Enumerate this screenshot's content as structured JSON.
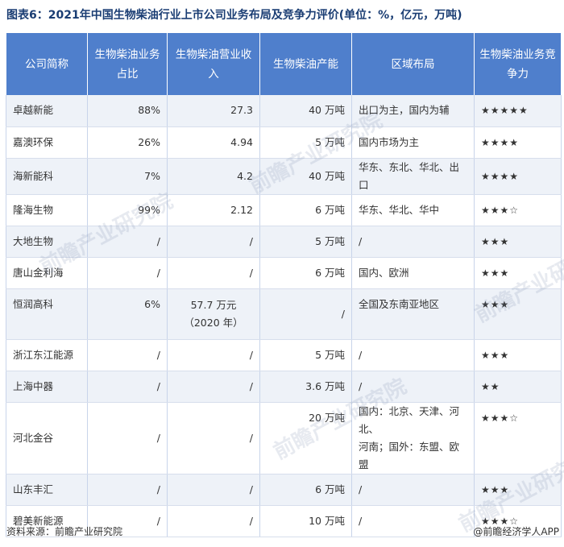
{
  "title": "图表6：2021年中国生物柴油行业上市公司业务布局及竞争力评价(单位：%，亿元，万吨)",
  "table": {
    "headers": [
      "公司简称",
      "生物柴油业务占比",
      "生物柴油营业收入",
      "生物柴油产能",
      "区域布局",
      "生物柴油业务竞争力"
    ],
    "rows": [
      {
        "name": "卓越新能",
        "share": "88%",
        "revenue": "27.3",
        "revenue2": "",
        "capacity": "40 万吨",
        "region": "出口为主，国内为辅",
        "stars": "★★★★★"
      },
      {
        "name": "嘉澳环保",
        "share": "26%",
        "revenue": "4.94",
        "revenue2": "",
        "capacity": "5 万吨",
        "region": "国内市场为主",
        "stars": "★★★★"
      },
      {
        "name": "海新能科",
        "share": "7%",
        "revenue": "4.2",
        "revenue2": "",
        "capacity": "40 万吨",
        "region": "华东、东北、华北、出口",
        "stars": "★★★★"
      },
      {
        "name": "隆海生物",
        "share": "99%",
        "revenue": "2.12",
        "revenue2": "",
        "capacity": "6 万吨",
        "region": "华东、华北、华中",
        "stars": "★★★☆"
      },
      {
        "name": "大地生物",
        "share": "/",
        "revenue": "/",
        "revenue2": "",
        "capacity": "5 万吨",
        "region": "/",
        "stars": "★★★"
      },
      {
        "name": "唐山金利海",
        "share": "/",
        "revenue": "/",
        "revenue2": "",
        "capacity": "6 万吨",
        "region": "国内、欧洲",
        "stars": "★★★"
      },
      {
        "name": "恒润高科",
        "share": "6%",
        "revenue": "57.7 万元",
        "revenue2": "（2020 年）",
        "capacity": "/",
        "region": "全国及东南亚地区",
        "stars": "★★★"
      },
      {
        "name": "浙江东江能源",
        "share": "/",
        "revenue": "/",
        "revenue2": "",
        "capacity": "5 万吨",
        "region": "/",
        "stars": "★★★"
      },
      {
        "name": "上海中器",
        "share": "/",
        "revenue": "/",
        "revenue2": "",
        "capacity": "3.6 万吨",
        "region": "/",
        "stars": "★★"
      },
      {
        "name": "河北金谷",
        "share": "/",
        "revenue": "/",
        "revenue2": "",
        "capacity": "20 万吨",
        "region": "国内：北京、天津、河北、",
        "region2": "河南；国外：东盟、欧盟",
        "stars": "★★★☆"
      },
      {
        "name": "山东丰汇",
        "share": "/",
        "revenue": "/",
        "revenue2": "",
        "capacity": "6 万吨",
        "region": "/",
        "stars": "★★★"
      },
      {
        "name": "碧美新能源",
        "share": "/",
        "revenue": "/",
        "revenue2": "",
        "capacity": "10 万吨",
        "region": "/",
        "stars": "★★★☆"
      }
    ]
  },
  "footer": {
    "source": "资料来源：前瞻产业研究院",
    "brand": "@前瞻经济学人APP"
  },
  "watermark": "前瞻产业研究院"
}
